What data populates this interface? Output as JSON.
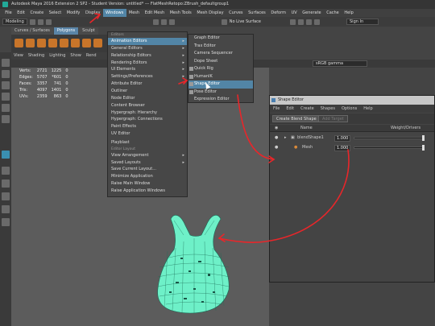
{
  "window_title": "Autodesk Maya 2016 Extension 2 SP2 - Student Version: untitled*  ---  FlatMeshRetopo:ZBrush_defaultgroup1",
  "menubar": [
    "File",
    "Edit",
    "Create",
    "Select",
    "Modify",
    "Display",
    "Windows",
    "Mesh",
    "Edit Mesh",
    "Mesh Tools",
    "Mesh Display",
    "Curves",
    "Surfaces",
    "Deform",
    "UV",
    "Generate",
    "Cache",
    "Help"
  ],
  "menubar_active": "Windows",
  "toolbar": {
    "mode": "Modeling",
    "live_surface": "No Live Surface",
    "signin": "Sign In"
  },
  "shelf_tabs": [
    "Curves / Surfaces",
    "Polygons",
    "Sculpt"
  ],
  "shelf_tab_selected": "Polygons",
  "panel_menu": [
    "View",
    "Shading",
    "Lighting",
    "Show",
    "Rend"
  ],
  "hud": {
    "rows": [
      {
        "label": "Verts:",
        "a": "2721",
        "b": "1225",
        "c": "0"
      },
      {
        "label": "Edges:",
        "a": "5707",
        "b": "*601",
        "c": "0"
      },
      {
        "label": "Faces:",
        "a": "3357",
        "b": "741",
        "c": "0"
      },
      {
        "label": "Tris:",
        "a": "4097",
        "b": "1401",
        "c": "0"
      },
      {
        "label": "UVs:",
        "a": "2359",
        "b": "863",
        "c": "0"
      }
    ]
  },
  "color_space": "sRGB gamma",
  "windows_menu": {
    "header_editors": "Editors",
    "items": [
      {
        "label": "Animation Editors",
        "submenu": true,
        "selected": true
      },
      {
        "label": "General Editors",
        "submenu": true
      },
      {
        "label": "Relationship Editors",
        "submenu": true
      },
      {
        "label": "Rendering Editors",
        "submenu": true
      },
      {
        "label": "UI Elements",
        "submenu": true
      },
      {
        "label": "Settings/Preferences",
        "submenu": true
      },
      {
        "label": "Attribute Editor"
      },
      {
        "label": "Outliner"
      },
      {
        "label": "Node Editor"
      },
      {
        "label": "Content Browser"
      },
      {
        "label": "Hypergraph: Hierarchy"
      },
      {
        "label": "Hypergraph: Connections"
      },
      {
        "label": "Paint Effects"
      },
      {
        "label": "UV Editor"
      },
      {
        "label": "Playblast"
      },
      {
        "label": "View Arrangement",
        "submenu": true
      },
      {
        "label": "Saved Layouts",
        "submenu": true
      },
      {
        "label": "Save Current Layout..."
      },
      {
        "label": "Minimize Application"
      },
      {
        "label": "Raise Main Window"
      },
      {
        "label": "Raise Application Windows"
      }
    ],
    "header_layout": "Editor Layout"
  },
  "animation_submenu": [
    {
      "label": "Graph Editor"
    },
    {
      "label": "Trax Editor"
    },
    {
      "label": "Camera Sequencer"
    },
    {
      "label": "Dope Sheet"
    },
    {
      "label": "Quick Rig"
    },
    {
      "label": "HumanIK"
    },
    {
      "label": "Shape Editor",
      "selected": true
    },
    {
      "label": "Pose Editor"
    },
    {
      "label": "Expression Editor"
    }
  ],
  "shape_editor": {
    "title": "Shape Editor",
    "menu": [
      "File",
      "Edit",
      "Create",
      "Shapes",
      "Options",
      "Help"
    ],
    "create_button": "Create Blend Shape",
    "add_target_button": "Add Target",
    "col_name": "Name",
    "col_weight": "Weight/Drivers",
    "rows": [
      {
        "name": "blendShape1",
        "value": "1.000"
      },
      {
        "name": "Mesh",
        "value": "1.000"
      }
    ]
  },
  "colors": {
    "highlight": "#5285a6",
    "annotation_red": "#e8262a",
    "mesh_green": "#6ef0c8"
  }
}
